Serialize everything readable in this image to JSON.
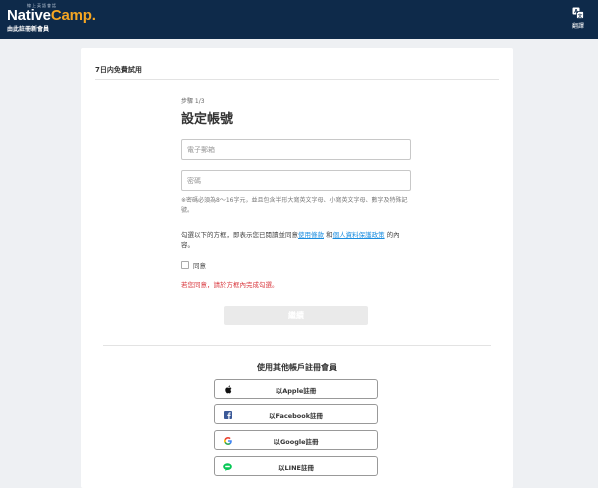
{
  "header": {
    "tagline": "線上英語會話",
    "logo_main": "Native",
    "logo_accent": "Camp.",
    "logo_sub": "由此註冊新會員",
    "translate_label": "翻譯"
  },
  "card": {
    "title": "7日内免費試用"
  },
  "form": {
    "step": "步驟 1/3",
    "title": "設定帳號",
    "email_placeholder": "電子郵箱",
    "password_placeholder": "密碼",
    "password_hint": "※密碼必須為8～16字元，並且包含半形大寫英文字母、小寫英文字母、數字及特殊記號。",
    "consent_prefix": "勾選以下的方框，即表示您已閱讀並同意",
    "terms_link": "使用條款",
    "consent_and": " 和",
    "privacy_link": "個人資料保護政策",
    "consent_suffix": " 的內容。",
    "agree_label": "同意",
    "error_text": "若您同意，請於方框內完成勾選。",
    "continue_label": "繼續"
  },
  "social": {
    "title": "使用其他帳戶註冊會員",
    "apple": "以Apple註冊",
    "facebook": "以Facebook註冊",
    "google": "以Google註冊",
    "line": "以LINE註冊"
  },
  "colors": {
    "header_bg": "#0e2a4a",
    "logo_accent": "#f5a623",
    "link": "#1a8de0",
    "error": "#d9383e",
    "facebook": "#3b5998",
    "line": "#06c755"
  }
}
